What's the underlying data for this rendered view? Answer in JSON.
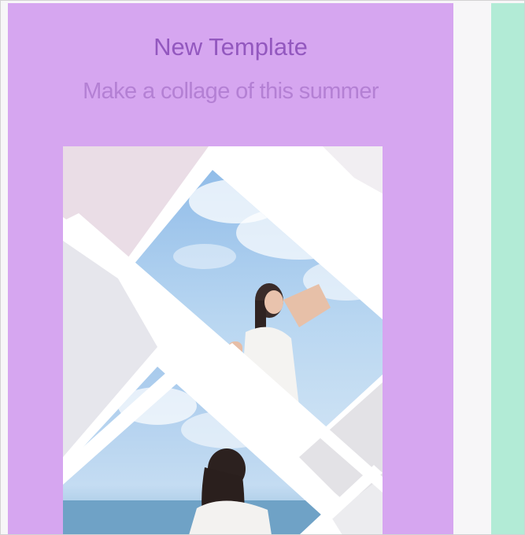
{
  "template_card": {
    "title": "New Template",
    "subtitle": "Make a collage of this summer",
    "accent_color": "#d6a6f0",
    "title_color": "#9358bf"
  },
  "next_card": {
    "accent_color": "#b2ebd6"
  }
}
